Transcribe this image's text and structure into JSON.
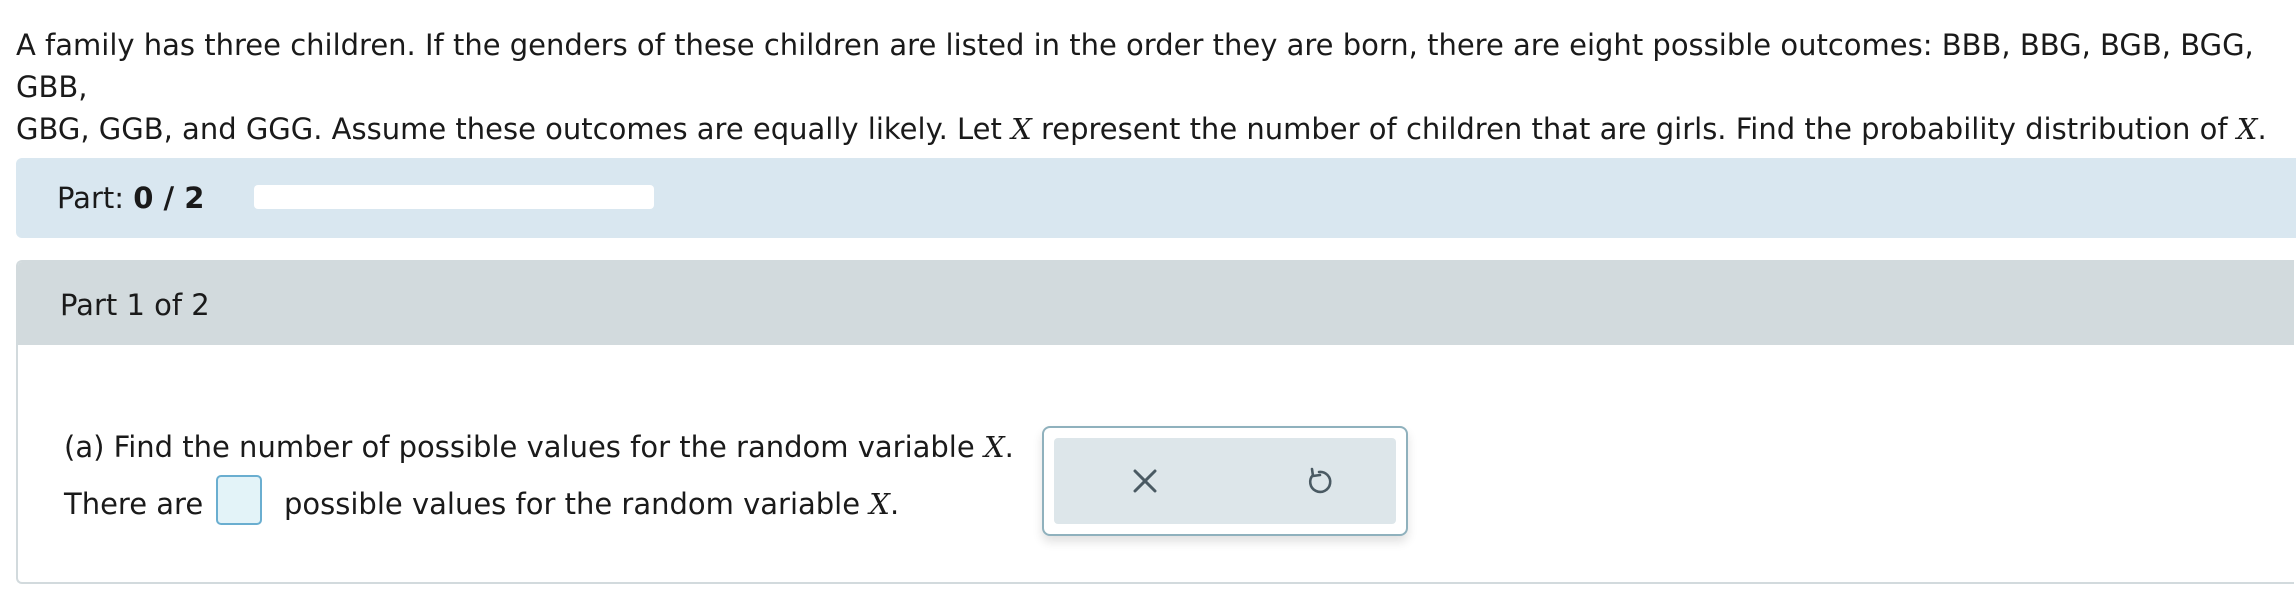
{
  "problem": {
    "line1": "A family has three children. If the genders of these children are listed in the order they are born, there are eight possible outcomes: BBB, BBG, BGB, BGG, GBB,",
    "line2_a": "GBG, GGB, and GGG. Assume these outcomes are equally likely. Let ",
    "var": "X",
    "line2_b": " represent the number of children that are girls. Find the probability distribution of ",
    "line2_end": "."
  },
  "part_progress": {
    "label": "Part: ",
    "value": "0 / 2",
    "fraction": 0
  },
  "part_card": {
    "header": "Part 1 of 2",
    "question_a_text": "(a) Find the number of possible values for the random variable ",
    "question_a_end": ".",
    "answer_prefix": "There are",
    "answer_value": "",
    "answer_suffix": "possible values for the random variable ",
    "answer_end": "."
  },
  "tools": {
    "clear_icon": "close-icon",
    "undo_icon": "undo-icon",
    "icon_color": "#4a5a63"
  }
}
